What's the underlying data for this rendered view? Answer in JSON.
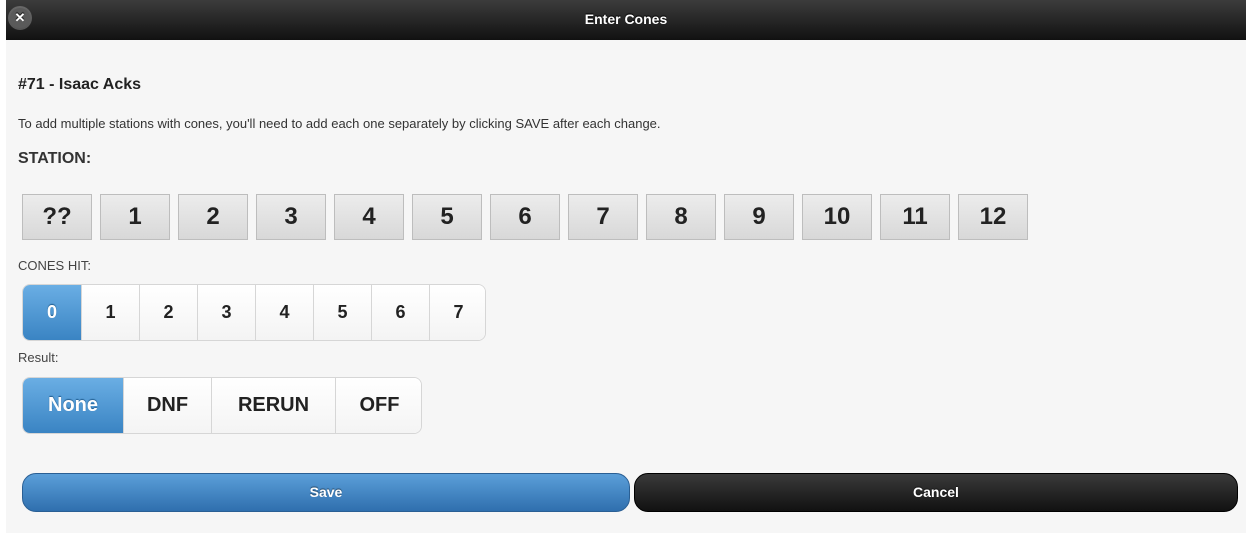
{
  "header": {
    "title": "Enter Cones",
    "close_glyph": "✕"
  },
  "driver": {
    "name": "#71 - Isaac Acks"
  },
  "instructions": "To add multiple stations with cones, you'll need to add each one separately by clicking SAVE after each change.",
  "station": {
    "label": "STATION:",
    "options": [
      "??",
      "1",
      "2",
      "3",
      "4",
      "5",
      "6",
      "7",
      "8",
      "9",
      "10",
      "11",
      "12"
    ]
  },
  "cones_hit": {
    "label": "CONES HIT:",
    "options": [
      "0",
      "1",
      "2",
      "3",
      "4",
      "5",
      "6",
      "7"
    ],
    "selected": "0"
  },
  "result": {
    "label": "Result:",
    "options": [
      "None",
      "DNF",
      "RERUN",
      "OFF"
    ],
    "selected": "None"
  },
  "actions": {
    "save_label": "Save",
    "cancel_label": "Cancel"
  },
  "colors": {
    "accent": "#3a84c3",
    "header": "#1a1a1a"
  }
}
